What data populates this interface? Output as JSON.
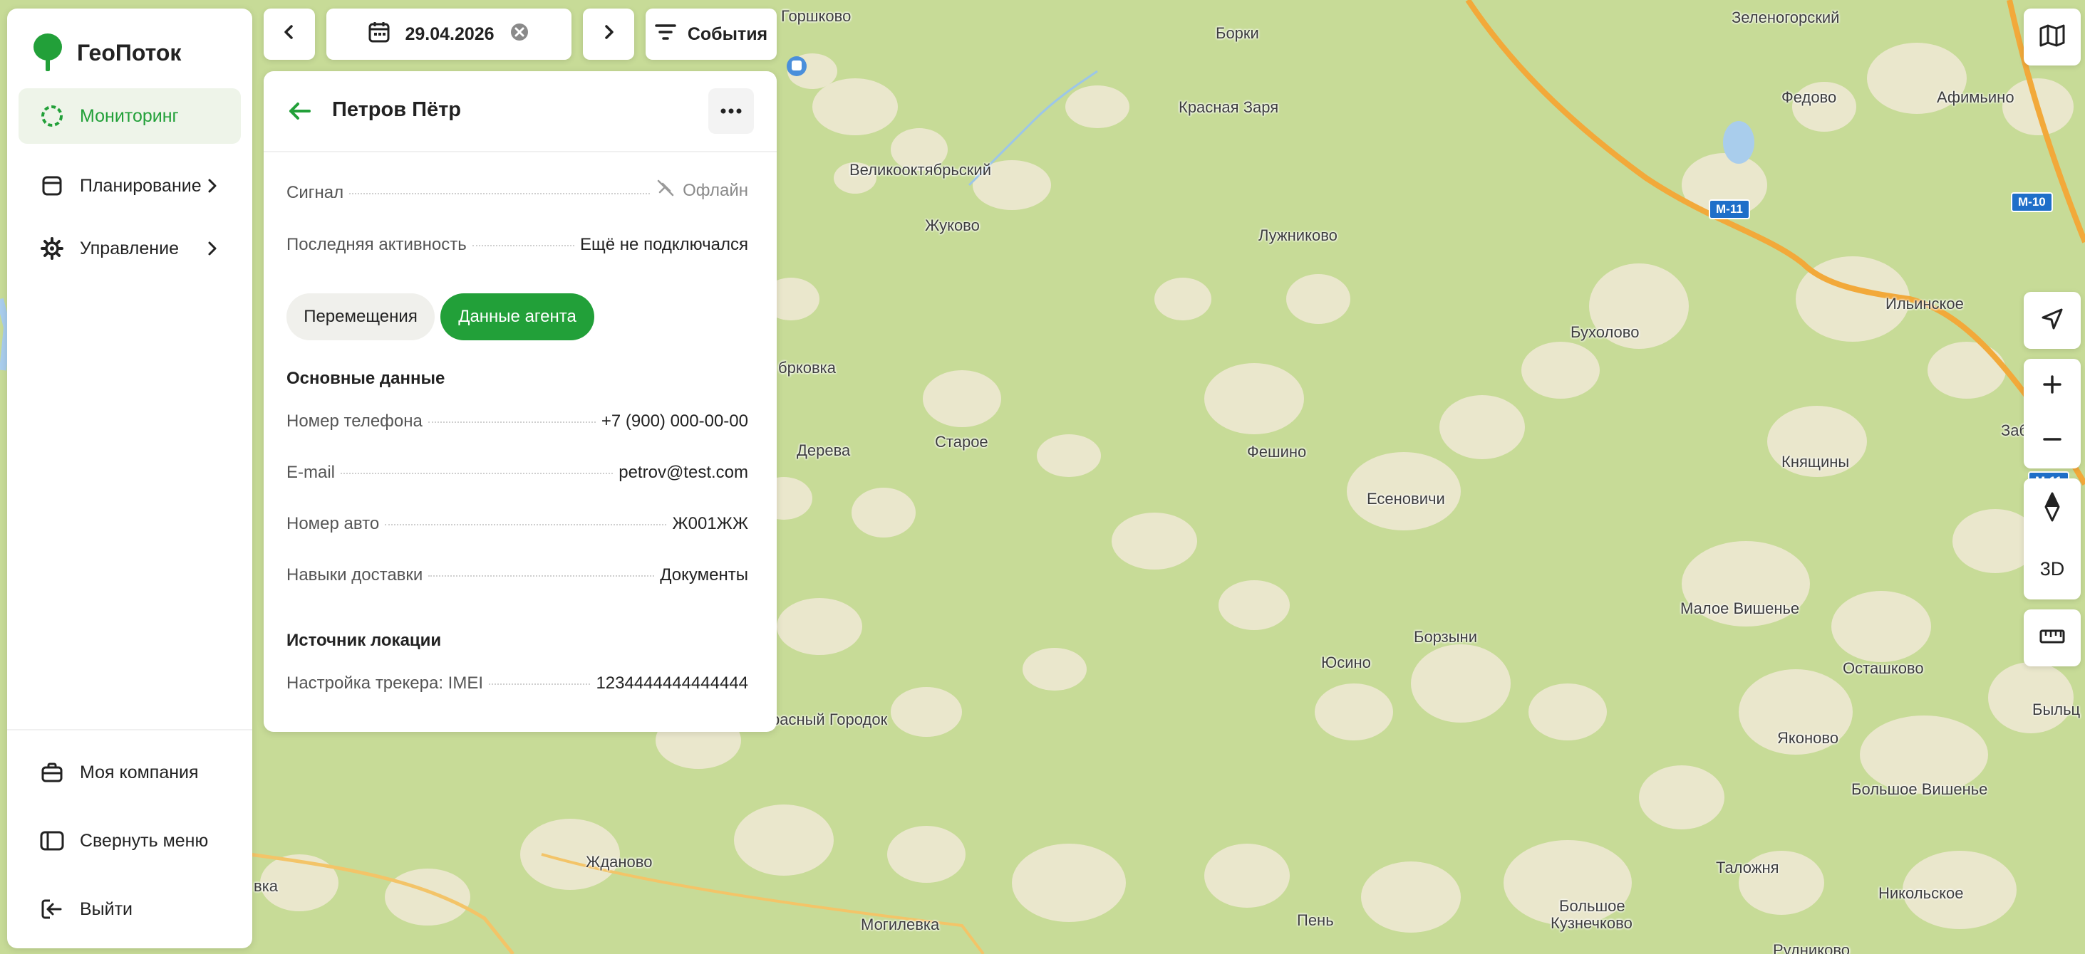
{
  "app": {
    "brand": "ГеоПоток",
    "accent": "#22a039"
  },
  "sidebar": {
    "items": [
      {
        "label": "Мониторинг",
        "icon": "monitoring-spinner-icon",
        "active": true
      },
      {
        "label": "Планирование",
        "icon": "calendar-square-icon"
      },
      {
        "label": "Управление",
        "icon": "gear-icon"
      }
    ],
    "bottom": [
      {
        "label": "Моя компания",
        "icon": "briefcase-icon"
      },
      {
        "label": "Свернуть меню",
        "icon": "collapse-panel-icon"
      },
      {
        "label": "Выйти",
        "icon": "logout-icon"
      }
    ]
  },
  "toolbar": {
    "date": "29.04.2026",
    "events_label": "События"
  },
  "agent": {
    "name": "Петров Пётр",
    "signal_key": "Сигнал",
    "signal_value": "Офлайн",
    "last_activity_key": "Последняя активность",
    "last_activity_value": "Ещё не подключался",
    "tabs": [
      "Перемещения",
      "Данные агента"
    ],
    "active_tab": 1,
    "basic_section": "Основные данные",
    "fields": [
      {
        "k": "Номер телефона",
        "v": "+7 (900) 000-00-00"
      },
      {
        "k": "E-mail",
        "v": "petrov@test.com"
      },
      {
        "k": "Номер авто",
        "v": "Ж001ЖЖ"
      },
      {
        "k": "Навыки доставки",
        "v": "Документы"
      }
    ],
    "location_section": "Источник локации",
    "tracker_key": "Настройка трекера: IMEI",
    "tracker_value": "1234444444444444"
  },
  "map_controls": {
    "mode_3d": "3D"
  },
  "map": {
    "labels": [
      "Горшково",
      "Борки",
      "Зеленогорский",
      "Красная Заря",
      "Федово",
      "Афимьино",
      "Великооктябрьский",
      "Жуково",
      "Лужниково",
      "Бухолово",
      "Ильинское",
      "брковка",
      "Старое",
      "Дерева",
      "Фешино",
      "Есеновичи",
      "Заболот",
      "Княщины",
      "Малое Вишенье",
      "Осташково",
      "Юсино",
      "Борзыни",
      "расный Городок",
      "Яконово",
      "Большое Вишенье",
      "Быльц",
      "Жданово",
      "вка",
      "Могилевка",
      "Пень",
      "Большое",
      "Кузнечково",
      "Таложня",
      "Никольское",
      "Рудниково"
    ],
    "roads": [
      "М-11",
      "М-11",
      "М-11",
      "М-11",
      "М-11",
      "М-11",
      "М-10",
      "М10",
      "М-11"
    ]
  }
}
